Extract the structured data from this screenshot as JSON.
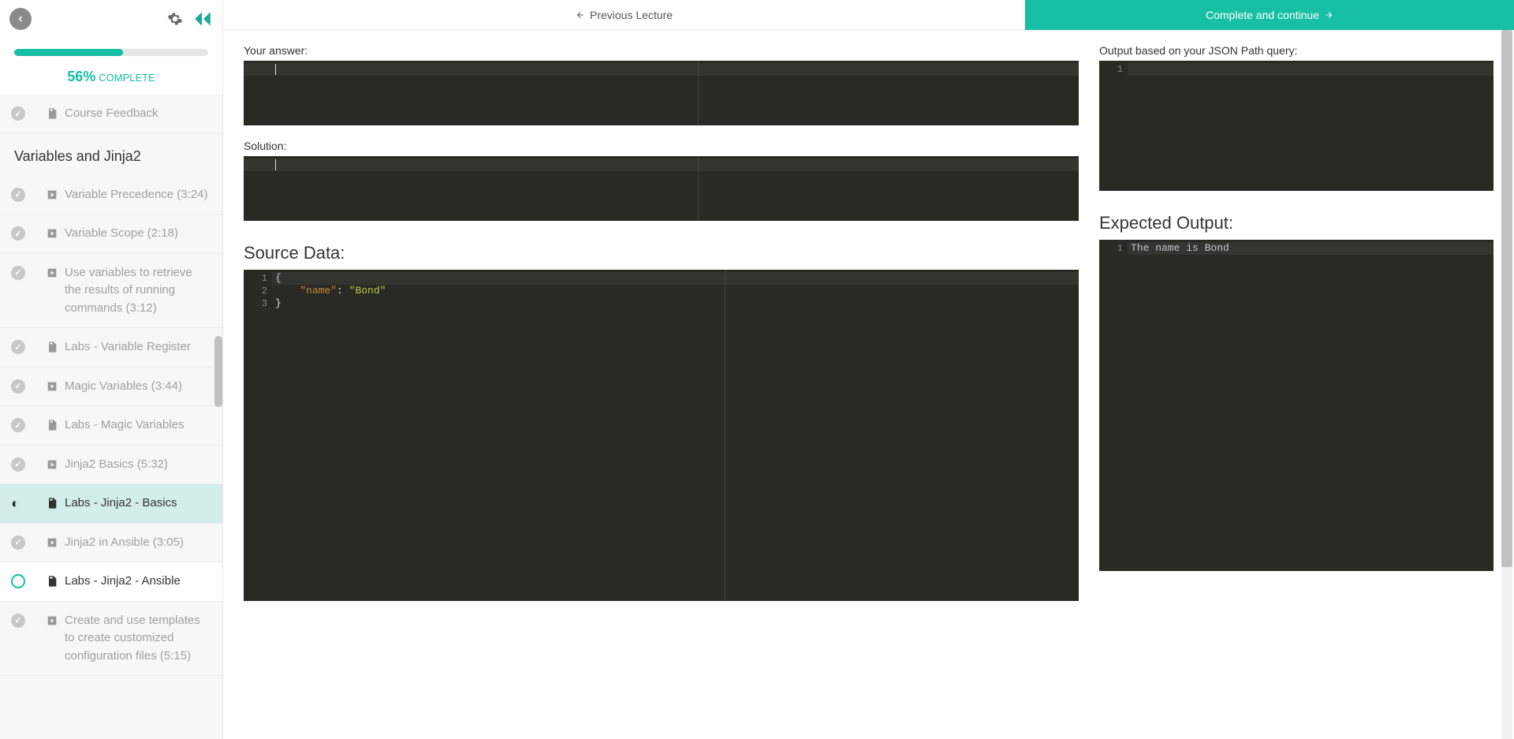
{
  "progress": {
    "percent": "56%",
    "label": "COMPLETE",
    "fill": 56
  },
  "topbar": {
    "prev": "Previous Lecture",
    "next": "Complete and continue"
  },
  "sidebar": {
    "feedback": "Course Feedback",
    "section_title": "Variables and Jinja2",
    "items": [
      {
        "label": "Variable Precedence (3:24)",
        "icon": "video",
        "status": "done"
      },
      {
        "label": "Variable Scope (2:18)",
        "icon": "video",
        "status": "done"
      },
      {
        "label": "Use variables to retrieve the results of running commands (3:12)",
        "icon": "video",
        "status": "done"
      },
      {
        "label": "Labs - Variable Register",
        "icon": "doc",
        "status": "done"
      },
      {
        "label": "Magic Variables (3:44)",
        "icon": "video",
        "status": "done"
      },
      {
        "label": "Labs - Magic Variables",
        "icon": "doc",
        "status": "done"
      },
      {
        "label": "Jinja2 Basics (5:32)",
        "icon": "video",
        "status": "done"
      },
      {
        "label": "Labs - Jinja2 - Basics",
        "icon": "doc",
        "status": "half"
      },
      {
        "label": "Jinja2 in Ansible (3:05)",
        "icon": "video",
        "status": "done"
      },
      {
        "label": "Labs - Jinja2 - Ansible",
        "icon": "doc",
        "status": "empty"
      },
      {
        "label": "Create and use templates to create customized configuration files (5:15)",
        "icon": "video",
        "status": "done"
      }
    ]
  },
  "labels": {
    "answer": "Your answer:",
    "solution": "Solution:",
    "source": "Source Data:",
    "output": "Output based on your JSON Path query:",
    "expected": "Expected Output:"
  },
  "source": {
    "lines": [
      "1",
      "2",
      "3"
    ],
    "content": [
      [
        {
          "t": "brace",
          "v": "{"
        }
      ],
      [
        {
          "t": "indent",
          "v": "    "
        },
        {
          "t": "key",
          "v": "\"name\""
        },
        {
          "t": "colon",
          "v": ": "
        },
        {
          "t": "str",
          "v": "\"Bond\""
        }
      ],
      [
        {
          "t": "brace",
          "v": "}"
        }
      ]
    ]
  },
  "output_empty": {
    "lines": [
      "1"
    ]
  },
  "expected": {
    "lines": [
      "1"
    ],
    "text": "The name is Bond"
  }
}
